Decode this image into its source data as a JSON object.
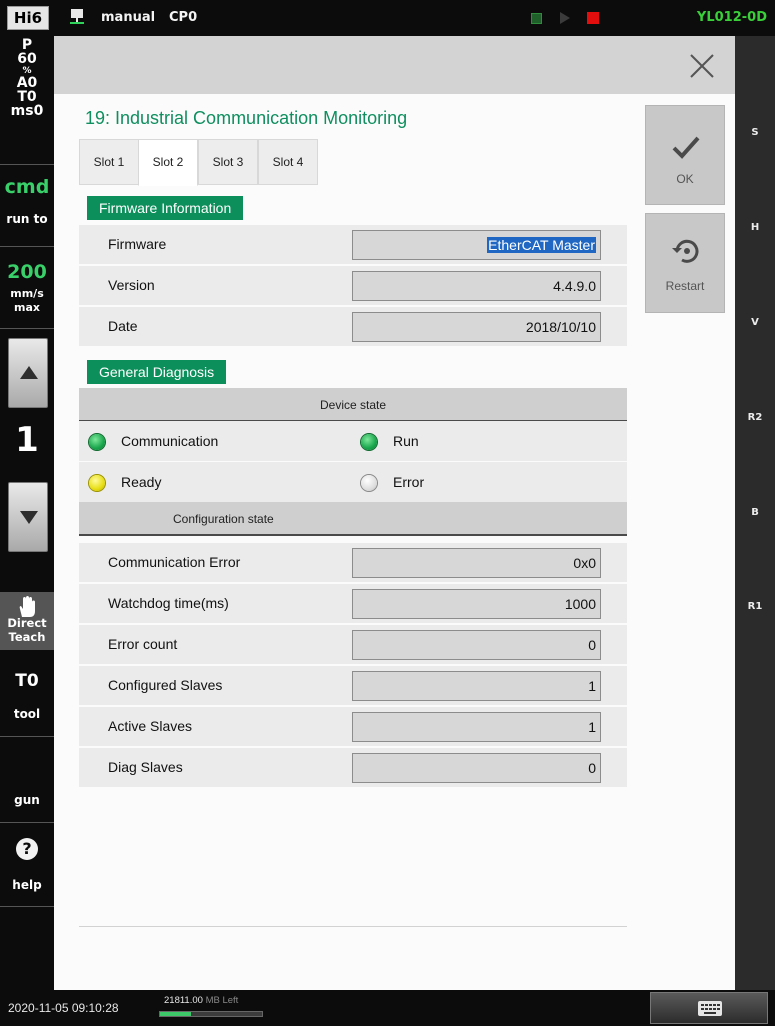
{
  "topbar": {
    "brand": "Hi6",
    "mode": "manual",
    "cp": "CP0",
    "robot_id": "YL012-0D",
    "indicators": {
      "green": "#2f8c3c",
      "red": "#e20d0d"
    }
  },
  "leftbar": {
    "status_p": "P",
    "status_p_value": "60",
    "status_percent": "%",
    "status_a": "A0",
    "status_t": "T0",
    "status_ms": "ms0",
    "cmd": "cmd",
    "run_to": "run to",
    "speed": "200",
    "speed_unit": "mm/s",
    "speed_mode": "max",
    "step": "1",
    "direct": "Direct",
    "teach": "Teach",
    "tool_number": "T0",
    "tool": "tool",
    "gun": "gun",
    "help_icon": "?",
    "help": "help"
  },
  "rightbar": {
    "labels": [
      "S",
      "H",
      "V",
      "R2",
      "B",
      "R1"
    ]
  },
  "dialog": {
    "title": "19: Industrial Communication Monitoring",
    "tabs": [
      "Slot 1",
      "Slot 2",
      "Slot 3",
      "Slot 4"
    ],
    "active_tab": "Slot 2",
    "ok_label": "OK",
    "restart_label": "Restart"
  },
  "firmware": {
    "header": "Firmware Information",
    "rows": [
      {
        "label": "Firmware",
        "value": "EtherCAT Master"
      },
      {
        "label": "Version",
        "value": "4.4.9.0"
      },
      {
        "label": "Date",
        "value": "2018/10/10"
      }
    ]
  },
  "diagnosis": {
    "header": "General Diagnosis",
    "device_state_title": "Device state",
    "device_states": [
      {
        "label": "Communication",
        "state": "green"
      },
      {
        "label": "Run",
        "state": "green"
      },
      {
        "label": "Ready",
        "state": "yellow"
      },
      {
        "label": "Error",
        "state": "off"
      }
    ],
    "config_state_title": "Configuration state",
    "config_rows": [
      {
        "label": "Communication Error",
        "value": "0x0"
      },
      {
        "label": "Watchdog time(ms)",
        "value": "1000"
      },
      {
        "label": "Error count",
        "value": "0"
      },
      {
        "label": "Configured Slaves",
        "value": "1"
      },
      {
        "label": "Active Slaves",
        "value": "1"
      },
      {
        "label": "Diag Slaves",
        "value": "0"
      }
    ]
  },
  "bottombar": {
    "datetime": "2020-11-05 09:10:28",
    "memory_value": "21811.00",
    "memory_unit": "MB Left",
    "memory_level": 0.3
  },
  "colors": {
    "accent_green": "#0d8f5b",
    "title_green": "#0f8f5f",
    "selection_blue": "#1f67c2"
  }
}
